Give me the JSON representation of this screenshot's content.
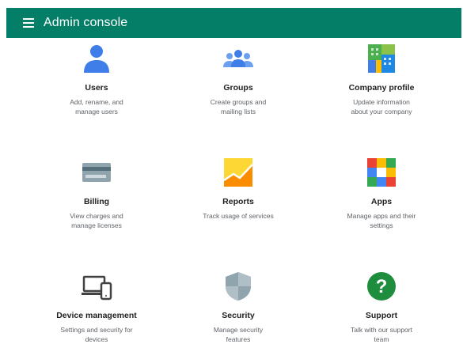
{
  "header": {
    "title": "Admin console"
  },
  "tiles": [
    {
      "icon": "user-icon",
      "name": "Users",
      "description": "Add, rename, and\nmanage users"
    },
    {
      "icon": "groups-icon",
      "name": "Groups",
      "description": "Create groups and\nmailing lists"
    },
    {
      "icon": "company-building-icon",
      "name": "Company profile",
      "description": "Update information\nabout your company"
    },
    {
      "icon": "credit-card-icon",
      "name": "Billing",
      "description": "View charges and\nmanage licenses"
    },
    {
      "icon": "reports-chart-icon",
      "name": "Reports",
      "description": "Track usage of services"
    },
    {
      "icon": "apps-grid-icon",
      "name": "Apps",
      "description": "Manage apps and their\nsettings"
    },
    {
      "icon": "devices-icon",
      "name": "Device management",
      "description": "Settings and security for\ndevices"
    },
    {
      "icon": "shield-icon",
      "name": "Security",
      "description": "Manage security\nfeatures"
    },
    {
      "icon": "help-question-icon",
      "name": "Support",
      "description": "Talk with our support\nteam"
    }
  ],
  "colors": {
    "header_bg": "#047e66",
    "accent_blue": "#3f7ee8",
    "support_green": "#1e8e3e"
  }
}
